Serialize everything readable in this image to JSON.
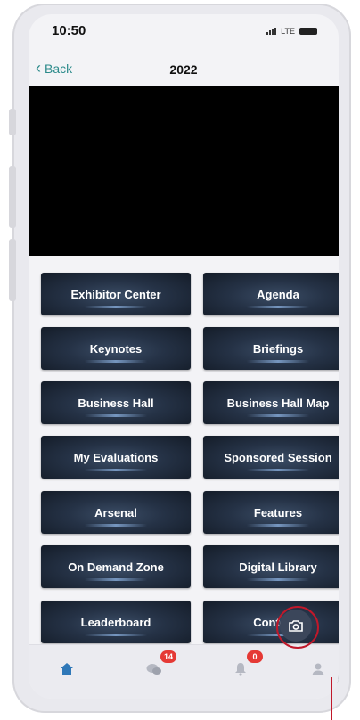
{
  "status": {
    "time": "10:50",
    "network": "LTE"
  },
  "nav": {
    "back_label": "Back",
    "title": "2022"
  },
  "tiles": [
    {
      "label": "Exhibitor Center"
    },
    {
      "label": "Agenda"
    },
    {
      "label": "Keynotes"
    },
    {
      "label": "Briefings"
    },
    {
      "label": "Business Hall"
    },
    {
      "label": "Business Hall Map"
    },
    {
      "label": "My Evaluations"
    },
    {
      "label": "Sponsored Session"
    },
    {
      "label": "Arsenal"
    },
    {
      "label": "Features"
    },
    {
      "label": "On Demand Zone"
    },
    {
      "label": "Digital Library"
    },
    {
      "label": "Leaderboard"
    },
    {
      "label": "Contests"
    }
  ],
  "tabbar": {
    "items": [
      {
        "icon": "home-icon",
        "badge": ""
      },
      {
        "icon": "chat-icon",
        "badge": "14"
      },
      {
        "icon": "bell-icon",
        "badge": "0"
      },
      {
        "icon": "person-icon",
        "badge": ""
      }
    ]
  },
  "colors": {
    "accent": "#2b8a8a",
    "tile": "#253246",
    "badge": "#e53935",
    "highlight": "#c0182a"
  }
}
